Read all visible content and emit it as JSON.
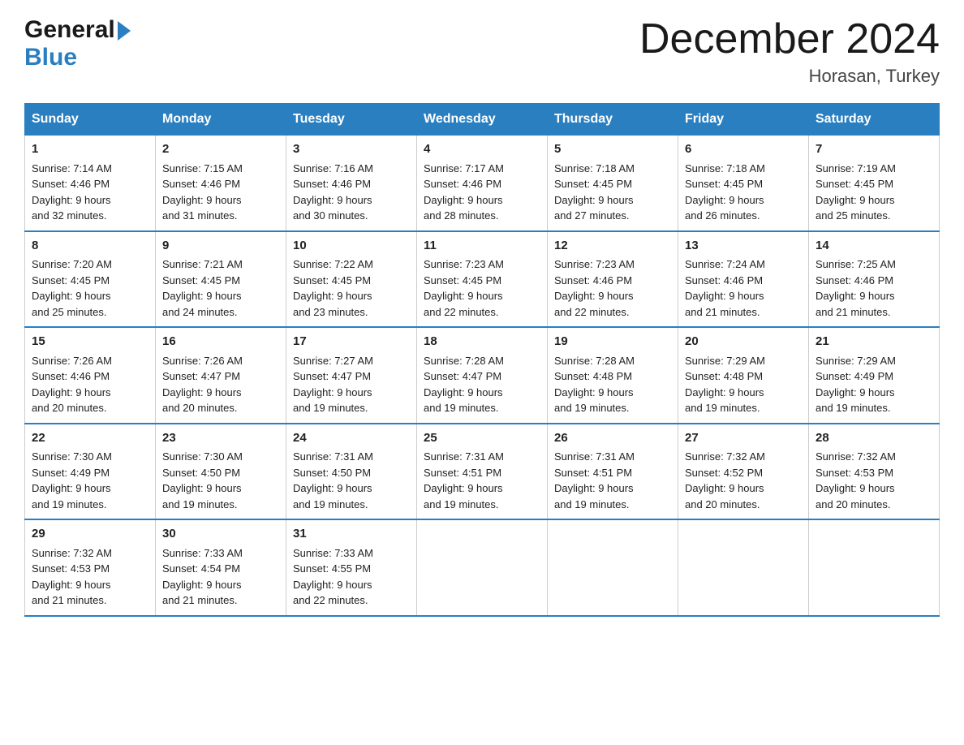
{
  "header": {
    "logo_general": "General",
    "logo_blue": "Blue",
    "month_title": "December 2024",
    "location": "Horasan, Turkey"
  },
  "days_of_week": [
    "Sunday",
    "Monday",
    "Tuesday",
    "Wednesday",
    "Thursday",
    "Friday",
    "Saturday"
  ],
  "weeks": [
    [
      {
        "day": "1",
        "sunrise": "7:14 AM",
        "sunset": "4:46 PM",
        "daylight": "9 hours and 32 minutes."
      },
      {
        "day": "2",
        "sunrise": "7:15 AM",
        "sunset": "4:46 PM",
        "daylight": "9 hours and 31 minutes."
      },
      {
        "day": "3",
        "sunrise": "7:16 AM",
        "sunset": "4:46 PM",
        "daylight": "9 hours and 30 minutes."
      },
      {
        "day": "4",
        "sunrise": "7:17 AM",
        "sunset": "4:46 PM",
        "daylight": "9 hours and 28 minutes."
      },
      {
        "day": "5",
        "sunrise": "7:18 AM",
        "sunset": "4:45 PM",
        "daylight": "9 hours and 27 minutes."
      },
      {
        "day": "6",
        "sunrise": "7:18 AM",
        "sunset": "4:45 PM",
        "daylight": "9 hours and 26 minutes."
      },
      {
        "day": "7",
        "sunrise": "7:19 AM",
        "sunset": "4:45 PM",
        "daylight": "9 hours and 25 minutes."
      }
    ],
    [
      {
        "day": "8",
        "sunrise": "7:20 AM",
        "sunset": "4:45 PM",
        "daylight": "9 hours and 25 minutes."
      },
      {
        "day": "9",
        "sunrise": "7:21 AM",
        "sunset": "4:45 PM",
        "daylight": "9 hours and 24 minutes."
      },
      {
        "day": "10",
        "sunrise": "7:22 AM",
        "sunset": "4:45 PM",
        "daylight": "9 hours and 23 minutes."
      },
      {
        "day": "11",
        "sunrise": "7:23 AM",
        "sunset": "4:45 PM",
        "daylight": "9 hours and 22 minutes."
      },
      {
        "day": "12",
        "sunrise": "7:23 AM",
        "sunset": "4:46 PM",
        "daylight": "9 hours and 22 minutes."
      },
      {
        "day": "13",
        "sunrise": "7:24 AM",
        "sunset": "4:46 PM",
        "daylight": "9 hours and 21 minutes."
      },
      {
        "day": "14",
        "sunrise": "7:25 AM",
        "sunset": "4:46 PM",
        "daylight": "9 hours and 21 minutes."
      }
    ],
    [
      {
        "day": "15",
        "sunrise": "7:26 AM",
        "sunset": "4:46 PM",
        "daylight": "9 hours and 20 minutes."
      },
      {
        "day": "16",
        "sunrise": "7:26 AM",
        "sunset": "4:47 PM",
        "daylight": "9 hours and 20 minutes."
      },
      {
        "day": "17",
        "sunrise": "7:27 AM",
        "sunset": "4:47 PM",
        "daylight": "9 hours and 19 minutes."
      },
      {
        "day": "18",
        "sunrise": "7:28 AM",
        "sunset": "4:47 PM",
        "daylight": "9 hours and 19 minutes."
      },
      {
        "day": "19",
        "sunrise": "7:28 AM",
        "sunset": "4:48 PM",
        "daylight": "9 hours and 19 minutes."
      },
      {
        "day": "20",
        "sunrise": "7:29 AM",
        "sunset": "4:48 PM",
        "daylight": "9 hours and 19 minutes."
      },
      {
        "day": "21",
        "sunrise": "7:29 AM",
        "sunset": "4:49 PM",
        "daylight": "9 hours and 19 minutes."
      }
    ],
    [
      {
        "day": "22",
        "sunrise": "7:30 AM",
        "sunset": "4:49 PM",
        "daylight": "9 hours and 19 minutes."
      },
      {
        "day": "23",
        "sunrise": "7:30 AM",
        "sunset": "4:50 PM",
        "daylight": "9 hours and 19 minutes."
      },
      {
        "day": "24",
        "sunrise": "7:31 AM",
        "sunset": "4:50 PM",
        "daylight": "9 hours and 19 minutes."
      },
      {
        "day": "25",
        "sunrise": "7:31 AM",
        "sunset": "4:51 PM",
        "daylight": "9 hours and 19 minutes."
      },
      {
        "day": "26",
        "sunrise": "7:31 AM",
        "sunset": "4:51 PM",
        "daylight": "9 hours and 19 minutes."
      },
      {
        "day": "27",
        "sunrise": "7:32 AM",
        "sunset": "4:52 PM",
        "daylight": "9 hours and 20 minutes."
      },
      {
        "day": "28",
        "sunrise": "7:32 AM",
        "sunset": "4:53 PM",
        "daylight": "9 hours and 20 minutes."
      }
    ],
    [
      {
        "day": "29",
        "sunrise": "7:32 AM",
        "sunset": "4:53 PM",
        "daylight": "9 hours and 21 minutes."
      },
      {
        "day": "30",
        "sunrise": "7:33 AM",
        "sunset": "4:54 PM",
        "daylight": "9 hours and 21 minutes."
      },
      {
        "day": "31",
        "sunrise": "7:33 AM",
        "sunset": "4:55 PM",
        "daylight": "9 hours and 22 minutes."
      },
      null,
      null,
      null,
      null
    ]
  ],
  "labels": {
    "sunrise": "Sunrise:",
    "sunset": "Sunset:",
    "daylight": "Daylight:"
  }
}
